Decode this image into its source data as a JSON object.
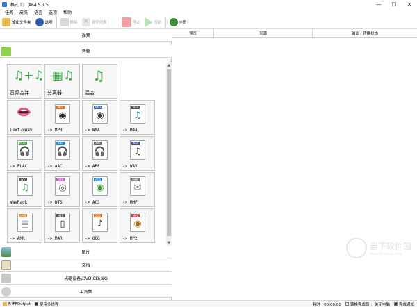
{
  "window": {
    "title": "格式工厂 X64 5.7.5",
    "min": "—",
    "max": "☐",
    "close": "✕"
  },
  "menu": [
    "任务",
    "皮肤",
    "语言",
    "选项",
    "帮助"
  ],
  "toolbar": {
    "output_folder": "输出文件夹",
    "options": "选项",
    "remove": "移除",
    "clear_list": "清空列表",
    "stop": "停止",
    "start": "开始",
    "home": "主页"
  },
  "categories": {
    "video": "视频",
    "audio": "音频",
    "picture": "图片",
    "document": "文档",
    "rom": "光驱设备\\DVD\\CD\\ISO",
    "tools": "工具集"
  },
  "tiles": [
    {
      "label": "音频合并",
      "tag": "",
      "glyph": "♫+♫"
    },
    {
      "label": "分离器",
      "tag": "",
      "glyph": "▦♫"
    },
    {
      "label": "混合",
      "tag": "",
      "glyph": "♫"
    },
    {
      "label": "Text->Wav",
      "tag": "",
      "glyph": "👄"
    },
    {
      "label": "-> MP3",
      "tag": "MP3",
      "glyph": "◉"
    },
    {
      "label": "-> WMA",
      "tag": "WMA",
      "glyph": "◉"
    },
    {
      "label": "-> M4A",
      "tag": "M4A",
      "glyph": "♫"
    },
    {
      "label": "-> FLAC",
      "tag": "FLAC",
      "glyph": "🎧"
    },
    {
      "label": "-> AAC",
      "tag": "AAC",
      "glyph": "🎧"
    },
    {
      "label": "-> APE",
      "tag": "APE",
      "glyph": "🎧"
    },
    {
      "label": "-> WAV",
      "tag": "WAV",
      "glyph": "♫"
    },
    {
      "label": "WavPack",
      "tag": "WV",
      "glyph": "♫"
    },
    {
      "label": "-> DTS",
      "tag": "DTS",
      "glyph": "◎"
    },
    {
      "label": "-> AC3",
      "tag": "AC3",
      "glyph": "◉"
    },
    {
      "label": "-> MMF",
      "tag": "MMF",
      "glyph": "✉"
    },
    {
      "label": "-> AMR",
      "tag": "AMR",
      "glyph": "▤"
    },
    {
      "label": "-> M4R",
      "tag": "M4R",
      "glyph": "▯"
    },
    {
      "label": "-> OGG",
      "tag": "OGG",
      "glyph": "♪"
    },
    {
      "label": "-> MP2",
      "tag": "MP2",
      "glyph": "◉"
    }
  ],
  "table": {
    "preview": "预览",
    "source": "来源",
    "output_status": "输出 / 转换状态"
  },
  "watermark": {
    "cn": "当下软件园",
    "url": "www.downxia.com"
  },
  "status": {
    "output_path": "F:\\FFOutput",
    "multithread": "使用多线程",
    "elapsed": "耗时 : 00:00:00",
    "after_convert": "转换完成后 :",
    "shutdown": "关闭电脑",
    "notify": "完成通知"
  },
  "colors": {
    "accent_green": "#3aa84a",
    "stop_red": "#e05050"
  }
}
